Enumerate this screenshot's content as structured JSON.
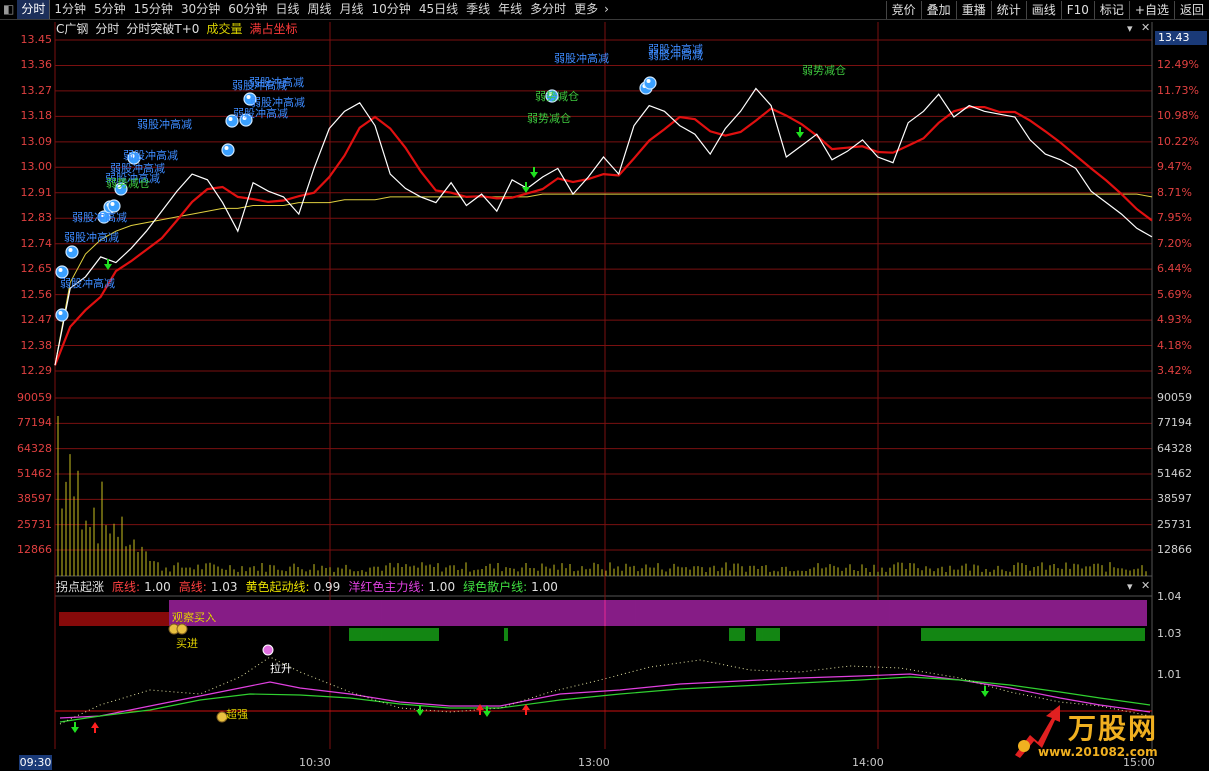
{
  "toolbar": {
    "tabs": [
      "分时",
      "1分钟",
      "5分钟",
      "15分钟",
      "30分钟",
      "60分钟",
      "日线",
      "周线",
      "月线",
      "10分钟",
      "45日线",
      "季线",
      "年线",
      "多分时",
      "更多"
    ],
    "active_tab": "分时",
    "right_buttons": [
      "竞价",
      "叠加",
      "重播",
      "统计",
      "画线",
      "F10",
      "标记",
      "+自选",
      "返回"
    ]
  },
  "header": {
    "stock": "C广钢",
    "view": "分时",
    "indicator": "分时突破T+0",
    "volume_label": "成交量",
    "coord_label": "满占坐标"
  },
  "price_axis": {
    "left": [
      "13.45",
      "13.36",
      "13.27",
      "13.18",
      "13.09",
      "13.00",
      "12.91",
      "12.83",
      "12.74",
      "12.65",
      "12.56",
      "12.47",
      "12.38",
      "12.29"
    ],
    "right": [
      "12.49%",
      "11.73%",
      "10.98%",
      "10.22%",
      "9.47%",
      "8.71%",
      "7.95%",
      "7.20%",
      "6.44%",
      "5.69%",
      "4.93%",
      "4.18%",
      "3.42%"
    ],
    "current_price": "13.43"
  },
  "volume_axis": [
    "90059",
    "77194",
    "64328",
    "51462",
    "38597",
    "25731",
    "12866"
  ],
  "indicator_panel": {
    "name": "拐点起涨",
    "items": [
      {
        "label": "底线:",
        "value": "1.00",
        "color": "#ff4040"
      },
      {
        "label": "高线:",
        "value": "1.03",
        "color": "#ff4040"
      },
      {
        "label": "黄色起动线:",
        "value": "0.99",
        "color": "#e8e000"
      },
      {
        "label": "洋红色主力线:",
        "value": "1.00",
        "color": "#e040e0"
      },
      {
        "label": "绿色散户线:",
        "value": "1.00",
        "color": "#40e040"
      }
    ],
    "axis": [
      "1.04",
      "1.03",
      "1.01"
    ]
  },
  "time_axis": {
    "start": "09:30",
    "ticks": [
      "10:30",
      "13:00",
      "14:00",
      "15:00"
    ]
  },
  "annotations": {
    "weak_breakout": "弱股冲高减",
    "weak_reduce": "弱势减仓",
    "pull_up": "拉升",
    "super_strong": "超强",
    "buy_in": "买进",
    "watch_buy": "观察买入"
  },
  "watermark": {
    "brand": "万股网",
    "url": "www.201082.com"
  },
  "chart_data": {
    "type": "line",
    "series": [
      {
        "name": "price",
        "values": [
          12.31,
          12.58,
          12.62,
          12.69,
          12.67,
          12.72,
          12.78,
          12.85,
          12.92,
          12.98,
          12.96,
          12.88,
          12.78,
          12.95,
          12.92,
          12.9,
          12.84,
          13.0,
          13.14,
          13.2,
          13.23,
          13.15,
          12.98,
          12.93,
          12.9,
          12.88,
          12.95,
          12.87,
          12.91,
          12.85,
          12.96,
          12.93,
          12.97,
          13.0,
          12.91,
          12.97,
          13.04,
          12.98,
          13.15,
          13.22,
          13.2,
          13.15,
          13.12,
          13.05,
          13.14,
          13.2,
          13.28,
          13.22,
          13.04,
          13.08,
          13.12,
          13.03,
          13.06,
          13.1,
          13.04,
          13.02,
          13.16,
          13.2,
          13.26,
          13.18,
          13.22,
          13.2,
          13.19,
          13.18,
          13.1,
          13.05,
          13.03,
          13.0,
          12.92,
          12.88,
          12.84,
          12.79,
          12.76
        ]
      },
      {
        "name": "avg",
        "values": [
          12.31,
          12.6,
          12.7,
          12.75,
          12.78,
          12.8,
          12.81,
          12.82,
          12.83,
          12.84,
          12.85,
          12.86,
          12.86,
          12.87,
          12.87,
          12.87,
          12.88,
          12.88,
          12.88,
          12.89,
          12.89,
          12.89,
          12.9,
          12.9,
          12.9,
          12.9,
          12.9,
          12.9,
          12.9,
          12.9,
          12.9,
          12.9,
          12.91,
          12.91,
          12.91,
          12.91,
          12.91,
          12.91,
          12.91,
          12.91,
          12.91,
          12.91,
          12.91,
          12.91,
          12.91,
          12.91,
          12.91,
          12.91,
          12.91,
          12.91,
          12.91,
          12.91,
          12.91,
          12.91,
          12.91,
          12.91,
          12.91,
          12.91,
          12.91,
          12.91,
          12.91,
          12.91,
          12.91,
          12.91,
          12.91,
          12.91,
          12.91,
          12.91,
          12.91,
          12.91,
          12.91,
          12.91,
          12.9
        ]
      }
    ],
    "ylim": [
      12.29,
      13.45
    ]
  }
}
